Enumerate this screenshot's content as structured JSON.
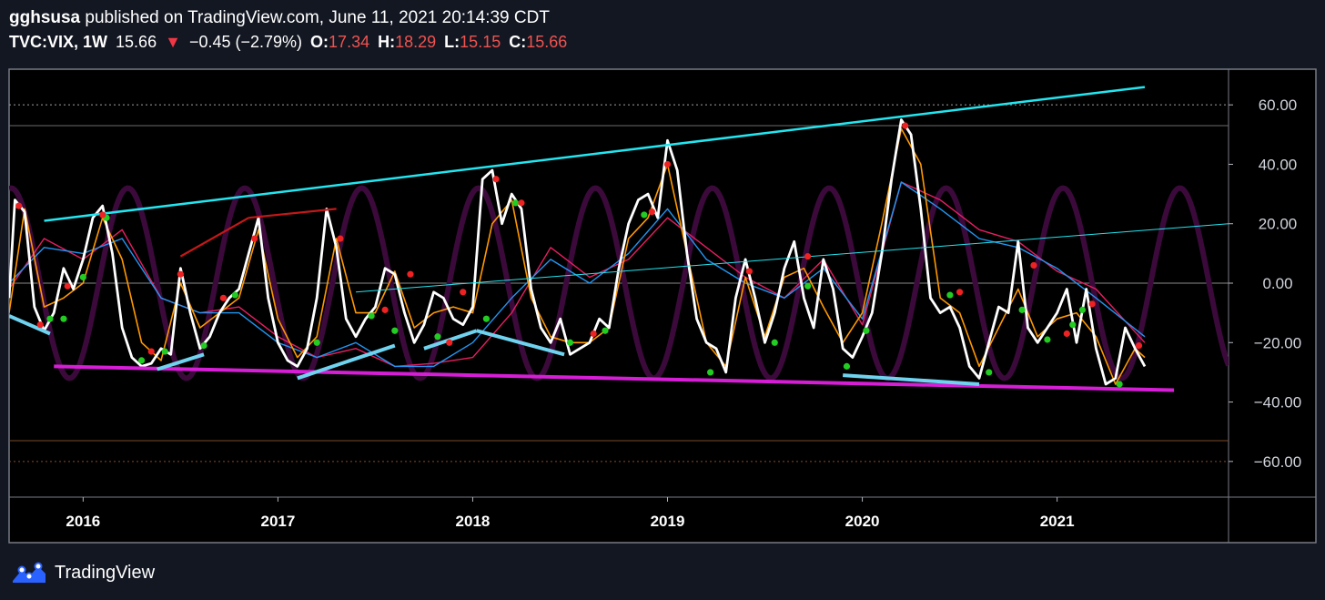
{
  "header": {
    "author": "gghsusa",
    "published_text": "published on TradingView.com, June 11, 2021 20:14:39 CDT",
    "symbol": "TVC:VIX, 1W",
    "last_price": "15.66",
    "change_arrow": "▼",
    "change": "−0.45 (−2.79%)",
    "open_label": "O:",
    "open_value": "17.34",
    "high_label": "H:",
    "high_value": "18.29",
    "low_label": "L:",
    "low_value": "15.15",
    "close_label": "C:",
    "close_value": "15.66"
  },
  "footer": {
    "brand": "TradingView",
    "logo_icon": "tradingview-logo-icon"
  },
  "colors": {
    "background": "#131722",
    "plot_bg": "#000000",
    "main_line": "#ffffff",
    "fast_line": "#ff9800",
    "signal_blue": "#2196f3",
    "signal_red": "#e91e63",
    "cycle": "#3b0a3b",
    "trend_cyan": "#22e6f0",
    "support_magenta": "#d61ed6",
    "swing_light_blue": "#6fd3ef",
    "dark_red": "#c41818",
    "dot_green": "#22cc22",
    "dot_red": "#ee2222"
  },
  "chart_data": {
    "type": "line",
    "title": "",
    "ylim": [
      -72,
      72
    ],
    "xlim": [
      2015.62,
      2021.88
    ],
    "y_ticks": [
      60,
      40,
      20,
      0,
      -20,
      -40,
      -60
    ],
    "y_tick_labels": [
      "60.00",
      "40.00",
      "20.00",
      "0.00",
      "−20.00",
      "−40.00",
      "−60.00"
    ],
    "x_ticks": [
      2016,
      2017,
      2018,
      2019,
      2020,
      2021
    ],
    "x_tick_labels": [
      "2016",
      "2017",
      "2018",
      "2019",
      "2020",
      "2021"
    ],
    "level_lines": [
      {
        "name": "upper-dotted",
        "value": 60,
        "style": "dotted"
      },
      {
        "name": "upper-solid",
        "value": 53,
        "style": "solid"
      },
      {
        "name": "zero",
        "value": 0,
        "style": "solid"
      },
      {
        "name": "lower-solid",
        "value": -53,
        "style": "solid"
      },
      {
        "name": "lower-dotted",
        "value": -60,
        "style": "dotted"
      }
    ],
    "cycle": {
      "amplitude": 32,
      "period_years": 0.6,
      "phase_year": 2015.63
    },
    "series": [
      {
        "key": "main",
        "x": [
          2015.62,
          2015.65,
          2015.7,
          2015.75,
          2015.8,
          2015.85,
          2015.9,
          2015.95,
          2016.0,
          2016.05,
          2016.1,
          2016.15,
          2016.2,
          2016.25,
          2016.3,
          2016.35,
          2016.4,
          2016.45,
          2016.5,
          2016.55,
          2016.6,
          2016.65,
          2016.7,
          2016.75,
          2016.8,
          2016.85,
          2016.9,
          2016.95,
          2017.0,
          2017.05,
          2017.1,
          2017.15,
          2017.2,
          2017.25,
          2017.3,
          2017.35,
          2017.4,
          2017.45,
          2017.5,
          2017.55,
          2017.6,
          2017.65,
          2017.7,
          2017.75,
          2017.8,
          2017.85,
          2017.9,
          2017.95,
          2018.0,
          2018.05,
          2018.1,
          2018.15,
          2018.2,
          2018.25,
          2018.3,
          2018.35,
          2018.4,
          2018.45,
          2018.5,
          2018.55,
          2018.6,
          2018.65,
          2018.7,
          2018.75,
          2018.8,
          2018.85,
          2018.9,
          2018.95,
          2019.0,
          2019.05,
          2019.1,
          2019.15,
          2019.2,
          2019.25,
          2019.3,
          2019.35,
          2019.4,
          2019.45,
          2019.5,
          2019.55,
          2019.6,
          2019.65,
          2019.7,
          2019.75,
          2019.8,
          2019.85,
          2019.9,
          2019.95,
          2020.0,
          2020.05,
          2020.1,
          2020.15,
          2020.2,
          2020.25,
          2020.3,
          2020.35,
          2020.4,
          2020.45,
          2020.5,
          2020.55,
          2020.6,
          2020.65,
          2020.7,
          2020.75,
          2020.8,
          2020.85,
          2020.9,
          2020.95,
          2021.0,
          2021.05,
          2021.1,
          2021.15,
          2021.2,
          2021.25,
          2021.3,
          2021.35,
          2021.4,
          2021.45
        ],
        "y": [
          -5,
          28,
          24,
          -8,
          -16,
          -10,
          5,
          -2,
          8,
          22,
          26,
          10,
          -15,
          -25,
          -28,
          -27,
          -22,
          -24,
          5,
          -10,
          -22,
          -18,
          -10,
          -5,
          -2,
          10,
          22,
          -5,
          -20,
          -26,
          -28,
          -22,
          -5,
          25,
          12,
          -12,
          -18,
          -12,
          -8,
          5,
          3,
          -10,
          -20,
          -14,
          -3,
          -5,
          -12,
          -14,
          -8,
          35,
          38,
          20,
          30,
          25,
          -2,
          -15,
          -20,
          -12,
          -24,
          -22,
          -20,
          -12,
          -15,
          5,
          20,
          28,
          30,
          22,
          48,
          38,
          10,
          -12,
          -20,
          -22,
          -30,
          -5,
          8,
          -5,
          -20,
          -10,
          5,
          14,
          -5,
          -15,
          8,
          -2,
          -22,
          -25,
          -18,
          -10,
          10,
          35,
          55,
          50,
          25,
          -5,
          -10,
          -8,
          -15,
          -28,
          -32,
          -20,
          -8,
          -10,
          14,
          -15,
          -20,
          -15,
          -10,
          -2,
          -20,
          -2,
          -22,
          -34,
          -32,
          -15,
          -22,
          -28
        ]
      },
      {
        "key": "fast",
        "x": [
          2015.62,
          2015.7,
          2015.8,
          2015.9,
          2016.0,
          2016.1,
          2016.2,
          2016.3,
          2016.4,
          2016.5,
          2016.6,
          2016.7,
          2016.8,
          2016.9,
          2017.0,
          2017.1,
          2017.2,
          2017.3,
          2017.4,
          2017.5,
          2017.6,
          2017.7,
          2017.8,
          2017.9,
          2018.0,
          2018.1,
          2018.2,
          2018.3,
          2018.4,
          2018.5,
          2018.6,
          2018.7,
          2018.8,
          2018.9,
          2019.0,
          2019.1,
          2019.2,
          2019.3,
          2019.4,
          2019.5,
          2019.6,
          2019.7,
          2019.8,
          2019.9,
          2020.0,
          2020.1,
          2020.2,
          2020.3,
          2020.4,
          2020.5,
          2020.6,
          2020.7,
          2020.8,
          2020.9,
          2021.0,
          2021.1,
          2021.2,
          2021.3,
          2021.4,
          2021.45
        ],
        "y": [
          -10,
          25,
          -8,
          -5,
          0,
          22,
          8,
          -20,
          -26,
          0,
          -15,
          -10,
          -5,
          18,
          -12,
          -25,
          -18,
          15,
          -10,
          -10,
          4,
          -15,
          -10,
          -8,
          -10,
          20,
          28,
          -5,
          -18,
          -20,
          -20,
          -15,
          15,
          22,
          40,
          10,
          -20,
          -28,
          2,
          -18,
          2,
          5,
          -8,
          -20,
          -10,
          20,
          52,
          40,
          -5,
          -10,
          -28,
          -15,
          -2,
          -18,
          -12,
          -10,
          -18,
          -34,
          -22,
          -25
        ]
      },
      {
        "key": "signal_blue",
        "x": [
          2015.62,
          2015.8,
          2016.0,
          2016.2,
          2016.4,
          2016.6,
          2016.8,
          2017.0,
          2017.2,
          2017.4,
          2017.6,
          2017.8,
          2018.0,
          2018.2,
          2018.4,
          2018.6,
          2018.8,
          2019.0,
          2019.2,
          2019.4,
          2019.6,
          2019.8,
          2020.0,
          2020.2,
          2020.4,
          2020.6,
          2020.8,
          2021.0,
          2021.2,
          2021.45
        ],
        "y": [
          0,
          12,
          10,
          15,
          -5,
          -10,
          -10,
          -20,
          -25,
          -20,
          -28,
          -28,
          -20,
          -5,
          8,
          0,
          10,
          25,
          8,
          0,
          -5,
          5,
          -12,
          34,
          25,
          15,
          12,
          5,
          -5,
          -18
        ]
      },
      {
        "key": "signal_red",
        "x": [
          2015.62,
          2015.8,
          2016.0,
          2016.2,
          2016.4,
          2016.6,
          2016.8,
          2017.0,
          2017.2,
          2017.4,
          2017.6,
          2017.8,
          2018.0,
          2018.2,
          2018.4,
          2018.6,
          2018.8,
          2019.0,
          2019.2,
          2019.4,
          2019.6,
          2019.8,
          2020.0,
          2020.2,
          2020.4,
          2020.6,
          2020.8,
          2021.0,
          2021.2,
          2021.45
        ],
        "y": [
          -2,
          15,
          8,
          18,
          -5,
          -10,
          -8,
          -18,
          -25,
          -22,
          -28,
          -27,
          -25,
          -10,
          12,
          2,
          8,
          22,
          12,
          2,
          -5,
          8,
          -14,
          34,
          28,
          18,
          14,
          4,
          -2,
          -20
        ]
      }
    ],
    "trendlines": [
      {
        "name": "upper-resistance",
        "color_key": "trend_cyan",
        "width": 2.5,
        "x": [
          2015.8,
          2021.45
        ],
        "y": [
          21,
          66
        ]
      },
      {
        "name": "mid-trend",
        "color_key": "trend_cyan",
        "width": 1,
        "x": [
          2017.4,
          2021.88
        ],
        "y": [
          -3,
          20
        ]
      },
      {
        "name": "lower-support",
        "color_key": "support_magenta",
        "width": 4,
        "x": [
          2015.85,
          2021.6
        ],
        "y": [
          -28,
          -36
        ]
      },
      {
        "name": "red-swing-1",
        "color_key": "dark_red",
        "width": 2.2,
        "x": [
          2016.5,
          2016.85
        ],
        "y": [
          9,
          22
        ]
      },
      {
        "name": "red-swing-2",
        "color_key": "dark_red",
        "width": 2.2,
        "x": [
          2016.85,
          2017.3
        ],
        "y": [
          22,
          25
        ]
      },
      {
        "name": "blue-swing-1",
        "color_key": "swing_light_blue",
        "width": 4,
        "x": [
          2015.62,
          2015.83
        ],
        "y": [
          -11,
          -17
        ]
      },
      {
        "name": "blue-swing-2",
        "color_key": "swing_light_blue",
        "width": 4,
        "x": [
          2016.38,
          2016.62
        ],
        "y": [
          -29,
          -24
        ]
      },
      {
        "name": "blue-swing-3",
        "color_key": "swing_light_blue",
        "width": 4,
        "x": [
          2017.1,
          2017.6
        ],
        "y": [
          -32,
          -21
        ]
      },
      {
        "name": "blue-swing-4",
        "color_key": "swing_light_blue",
        "width": 4,
        "x": [
          2017.75,
          2018.02
        ],
        "y": [
          -22,
          -16
        ]
      },
      {
        "name": "blue-swing-5",
        "color_key": "swing_light_blue",
        "width": 4,
        "x": [
          2018.02,
          2018.47
        ],
        "y": [
          -16,
          -24
        ]
      },
      {
        "name": "blue-swing-6",
        "color_key": "swing_light_blue",
        "width": 4,
        "x": [
          2019.9,
          2020.6
        ],
        "y": [
          -31,
          -34
        ]
      }
    ],
    "dots_green": [
      [
        2015.83,
        -12
      ],
      [
        2015.9,
        -12
      ],
      [
        2016.0,
        2
      ],
      [
        2016.12,
        22
      ],
      [
        2016.3,
        -26
      ],
      [
        2016.42,
        -23
      ],
      [
        2016.62,
        -21
      ],
      [
        2016.78,
        -4
      ],
      [
        2017.2,
        -20
      ],
      [
        2017.48,
        -11
      ],
      [
        2017.6,
        -16
      ],
      [
        2017.82,
        -18
      ],
      [
        2018.07,
        -12
      ],
      [
        2018.22,
        27
      ],
      [
        2018.5,
        -20
      ],
      [
        2018.68,
        -16
      ],
      [
        2018.88,
        23
      ],
      [
        2019.22,
        -30
      ],
      [
        2019.55,
        -20
      ],
      [
        2019.72,
        -1
      ],
      [
        2019.92,
        -28
      ],
      [
        2020.02,
        -16
      ],
      [
        2020.45,
        -4
      ],
      [
        2020.65,
        -30
      ],
      [
        2020.82,
        -9
      ],
      [
        2020.95,
        -19
      ],
      [
        2021.08,
        -14
      ],
      [
        2021.13,
        -9
      ],
      [
        2021.32,
        -34
      ]
    ],
    "dots_red": [
      [
        2015.67,
        26
      ],
      [
        2015.78,
        -14
      ],
      [
        2015.92,
        -1
      ],
      [
        2016.1,
        23
      ],
      [
        2016.35,
        -23
      ],
      [
        2016.5,
        3
      ],
      [
        2016.72,
        -5
      ],
      [
        2016.88,
        15
      ],
      [
        2017.32,
        15
      ],
      [
        2017.55,
        -9
      ],
      [
        2017.68,
        3
      ],
      [
        2017.88,
        -20
      ],
      [
        2017.95,
        -3
      ],
      [
        2018.12,
        35
      ],
      [
        2018.25,
        27
      ],
      [
        2018.62,
        -17
      ],
      [
        2018.92,
        24
      ],
      [
        2019.0,
        40
      ],
      [
        2019.42,
        4
      ],
      [
        2019.72,
        9
      ],
      [
        2020.22,
        53
      ],
      [
        2020.5,
        -3
      ],
      [
        2020.88,
        6
      ],
      [
        2021.05,
        -17
      ],
      [
        2021.18,
        -7
      ],
      [
        2021.42,
        -21
      ]
    ]
  }
}
